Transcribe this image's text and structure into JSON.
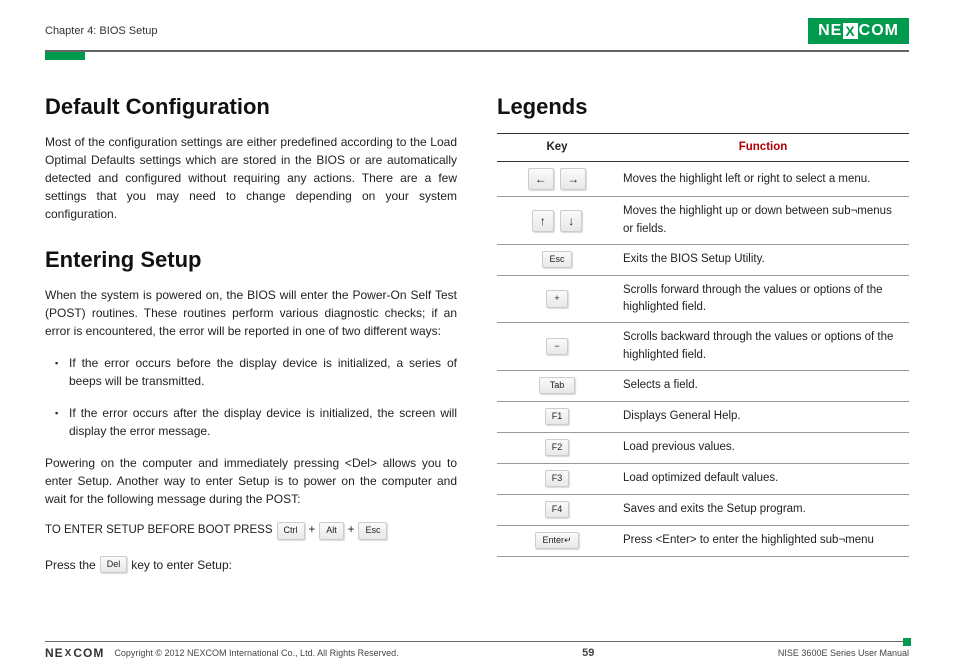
{
  "header": {
    "chapter": "Chapter 4: BIOS Setup",
    "logo_left": "NE",
    "logo_mid": "X",
    "logo_right": "COM"
  },
  "left": {
    "h1": "Default Configuration",
    "p1": "Most of the configuration settings are either predefined according to the Load Optimal Defaults settings which are stored in the BIOS or are automatically detected and configured without requiring any actions. There are a few settings that you may need to change depending on your system configuration.",
    "h2": "Entering Setup",
    "p2": "When the system is powered on, the BIOS will enter the Power-On Self Test (POST) routines. These routines perform various diagnostic checks; if an error is encountered, the error will be reported in one of two different ways:",
    "b1": "If the error occurs before the display device is initialized, a series of beeps will be transmitted.",
    "b2": "If the error occurs after the display device is initialized, the screen will display the error message.",
    "p3": "Powering on the computer and immediately pressing <Del> allows you to enter Setup. Another way to enter Setup is to power on the computer and wait for the following message during the POST:",
    "setup_prefix": "TO ENTER SETUP BEFORE BOOT PRESS",
    "k_ctrl": "Ctrl",
    "k_alt": "Alt",
    "k_esc": "Esc",
    "plus": "+",
    "press_a": "Press the",
    "k_del": "Del",
    "press_b": "key to enter Setup:"
  },
  "right": {
    "h1": "Legends",
    "th_key": "Key",
    "th_fn": "Function",
    "rows": {
      "r0": {
        "k1": "←",
        "k2": "→",
        "fn": "Moves the highlight left or right to select a menu."
      },
      "r1": {
        "k1": "↑",
        "k2": "↓",
        "fn": "Moves the highlight up or down between sub¬menus or fields."
      },
      "r2": {
        "k": "Esc",
        "fn": "Exits the BIOS Setup Utility."
      },
      "r3": {
        "k": "+",
        "fn": "Scrolls forward through the values or options of the highlighted field."
      },
      "r4": {
        "k": "−",
        "fn": "Scrolls backward through the values or options of the highlighted field."
      },
      "r5": {
        "k": "Tab",
        "fn": "Selects a field."
      },
      "r6": {
        "k": "F1",
        "fn": "Displays General Help."
      },
      "r7": {
        "k": "F2",
        "fn": "Load previous values."
      },
      "r8": {
        "k": "F3",
        "fn": "Load optimized default values."
      },
      "r9": {
        "k": "F4",
        "fn": "Saves and exits the Setup program."
      },
      "r10": {
        "k": "Enter↵",
        "fn": "Press <Enter> to enter the highlighted sub¬menu"
      }
    }
  },
  "footer": {
    "logo_left": "NE",
    "logo_mid": "X",
    "logo_right": "COM",
    "copyright": "Copyright © 2012 NEXCOM International Co., Ltd. All Rights Reserved.",
    "page": "59",
    "manual": "NISE 3600E Series User Manual"
  }
}
